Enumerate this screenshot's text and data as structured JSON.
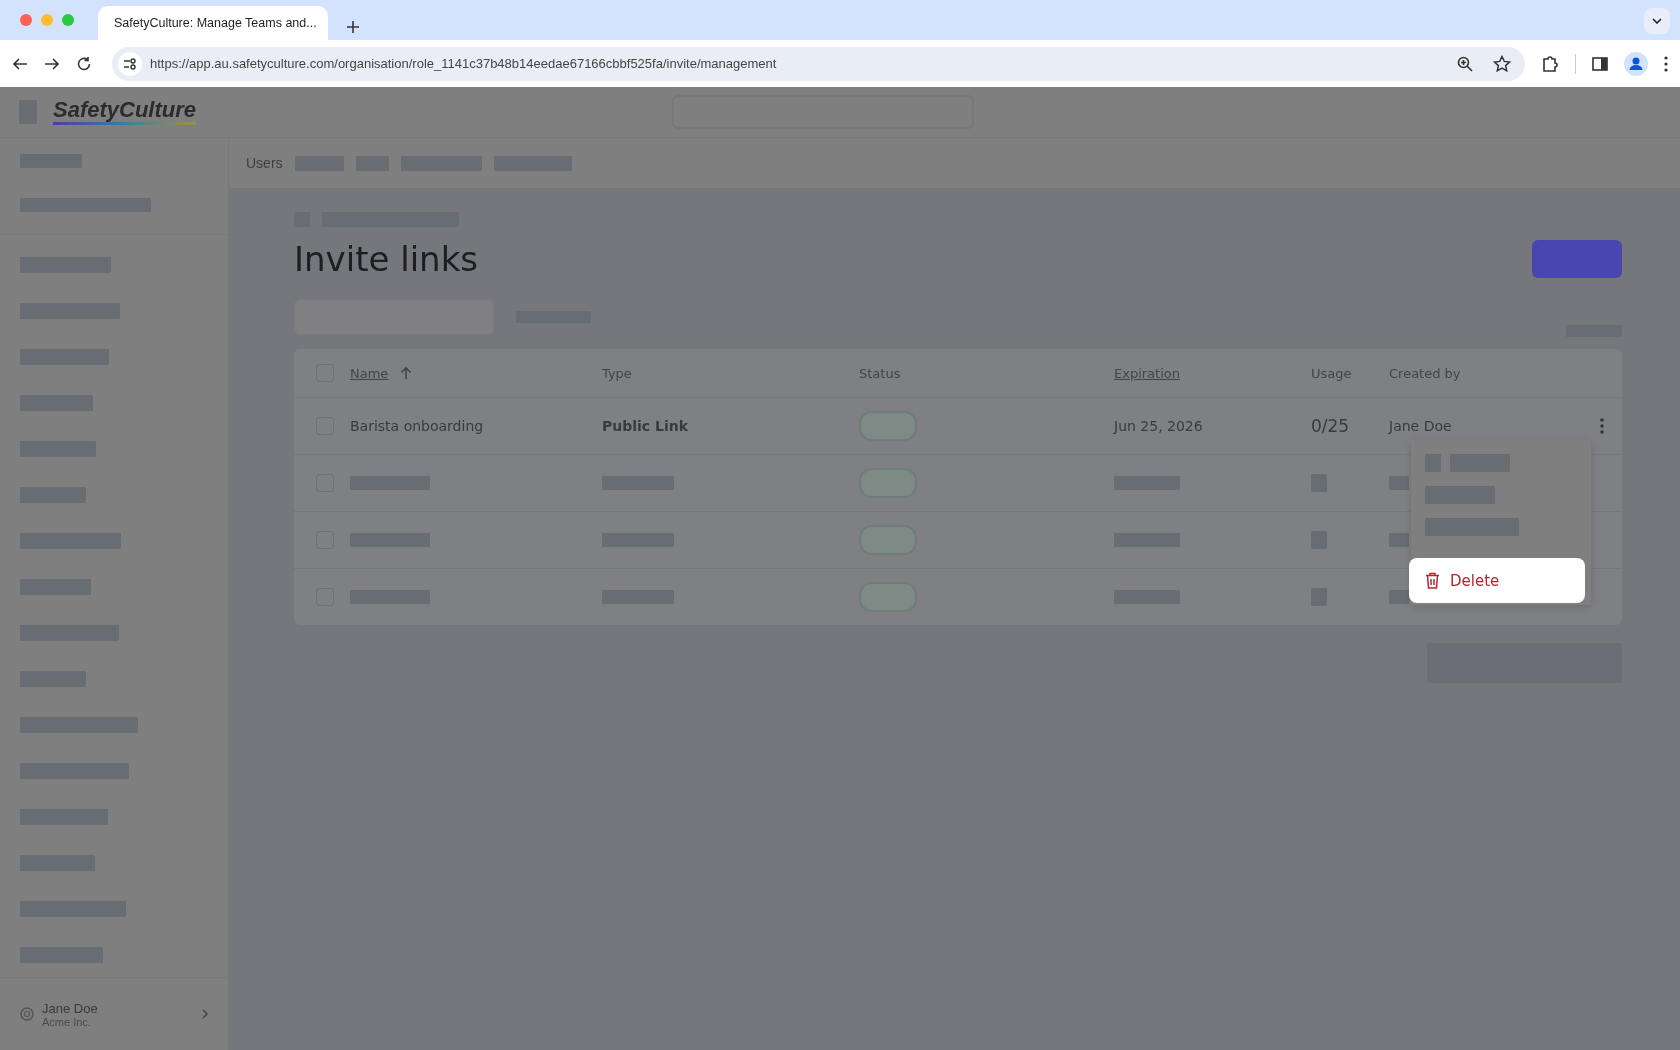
{
  "browser": {
    "tab_title": "SafetyCulture: Manage Teams and...",
    "url": "https://app.au.safetyculture.com/organisation/role_1141c37b48b14eedae67166cbbf525fa/invite/management"
  },
  "app": {
    "logo": "SafetyCulture"
  },
  "subnav": {
    "items": [
      "Users"
    ]
  },
  "page": {
    "title": "Invite links"
  },
  "table": {
    "select_all_checked": false,
    "columns": [
      {
        "label": "Name",
        "sortable": true,
        "sorted": true
      },
      {
        "label": "Type",
        "sortable": false,
        "sorted": false
      },
      {
        "label": "Status",
        "sortable": false,
        "sorted": false
      },
      {
        "label": "Expiration",
        "sortable": true,
        "sorted": false
      },
      {
        "label": "Usage",
        "sortable": false,
        "sorted": false
      },
      {
        "label": "Created by",
        "sortable": false,
        "sorted": false
      }
    ],
    "rows": [
      {
        "kind": "text",
        "checked": false,
        "name": "Barista onboarding",
        "type": "Public Link",
        "expiration": "Jun 25, 2026",
        "usage": "0/25",
        "created_by": "Jane Doe"
      },
      {
        "kind": "redacted",
        "checked": false
      },
      {
        "kind": "redacted",
        "checked": false
      },
      {
        "kind": "redacted",
        "checked": false
      }
    ]
  },
  "context_menu": {
    "items": [
      {
        "kind": "redacted"
      },
      {
        "kind": "redacted"
      },
      {
        "kind": "redacted"
      },
      {
        "kind": "action",
        "label": "Delete"
      }
    ]
  },
  "user": {
    "name": "Jane Doe",
    "organisation": "Acme Inc."
  }
}
